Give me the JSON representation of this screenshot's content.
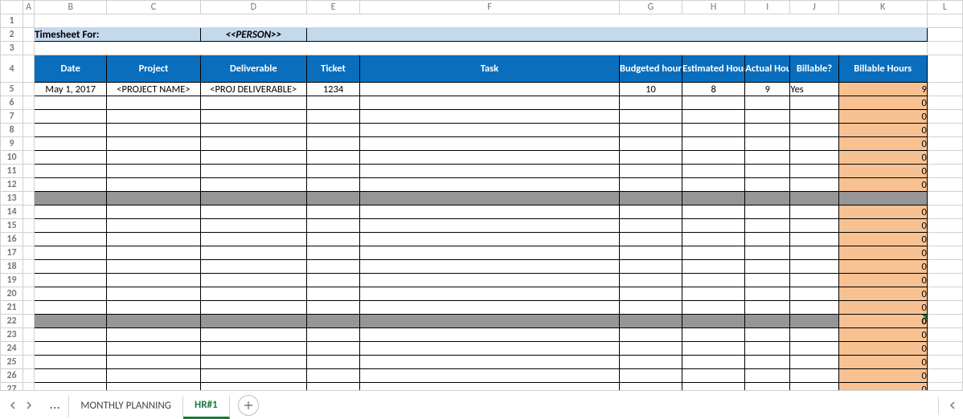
{
  "columns": [
    "A",
    "B",
    "C",
    "D",
    "E",
    "F",
    "G",
    "H",
    "I",
    "J",
    "K",
    "L"
  ],
  "rowsVisible": [
    "1",
    "2",
    "3",
    "4",
    "5",
    "6",
    "7",
    "8",
    "9",
    "10",
    "11",
    "12",
    "13",
    "14",
    "15",
    "16",
    "17",
    "18",
    "19",
    "20",
    "21",
    "22",
    "23",
    "24",
    "25",
    "26",
    "27"
  ],
  "title": {
    "label": "Timesheet For:",
    "person": "<<PERSON>>"
  },
  "headers": {
    "date": "Date",
    "project": "Project",
    "deliverable": "Deliverable",
    "ticket": "Ticket",
    "task": "Task",
    "budgeted": "Budgeted hours",
    "estimated": "Estimated Hours",
    "actual": "Actual Hours",
    "billableq": "Billable?",
    "billhours": "Billable Hours"
  },
  "rows": [
    {
      "rownum": "5",
      "date": "May 1, 2017",
      "project": "<PROJECT NAME>",
      "deliverable": "<PROJ DELIVERABLE>",
      "ticket": "1234",
      "task": "",
      "budgeted": "10",
      "estimated": "8",
      "actual": "9",
      "billableq": "Yes",
      "billhours": "9",
      "type": "data"
    },
    {
      "rownum": "6",
      "billhours": "0",
      "type": "data"
    },
    {
      "rownum": "7",
      "billhours": "0",
      "type": "data"
    },
    {
      "rownum": "8",
      "billhours": "0",
      "type": "data"
    },
    {
      "rownum": "9",
      "billhours": "0",
      "type": "data"
    },
    {
      "rownum": "10",
      "billhours": "0",
      "type": "data"
    },
    {
      "rownum": "11",
      "billhours": "0",
      "type": "data"
    },
    {
      "rownum": "12",
      "billhours": "0",
      "type": "data"
    },
    {
      "rownum": "13",
      "type": "sep"
    },
    {
      "rownum": "14",
      "billhours": "0",
      "type": "data"
    },
    {
      "rownum": "15",
      "billhours": "0",
      "type": "data"
    },
    {
      "rownum": "16",
      "billhours": "0",
      "type": "data"
    },
    {
      "rownum": "17",
      "billhours": "0",
      "type": "data"
    },
    {
      "rownum": "18",
      "billhours": "0",
      "type": "data"
    },
    {
      "rownum": "19",
      "billhours": "0",
      "type": "data"
    },
    {
      "rownum": "20",
      "billhours": "0",
      "type": "data"
    },
    {
      "rownum": "21",
      "billhours": "0",
      "type": "data"
    },
    {
      "rownum": "22",
      "billhours": "0",
      "type": "sep-ind"
    },
    {
      "rownum": "23",
      "billhours": "0",
      "type": "data"
    },
    {
      "rownum": "24",
      "billhours": "0",
      "type": "data"
    },
    {
      "rownum": "25",
      "billhours": "0",
      "type": "data"
    },
    {
      "rownum": "26",
      "billhours": "0",
      "type": "data"
    },
    {
      "rownum": "27",
      "billhours": "0",
      "type": "data"
    }
  ],
  "tabs": {
    "ellipsis": "...",
    "monthly": "MONTHLY PLANNING",
    "hr1": "HR#1"
  },
  "colWidths": {
    "row": 28,
    "A": 14,
    "B": 90,
    "C": 116,
    "D": 132,
    "E": 66,
    "F": 322,
    "G": 78,
    "H": 78,
    "I": 56,
    "J": 60,
    "K": 110,
    "L": 44
  }
}
